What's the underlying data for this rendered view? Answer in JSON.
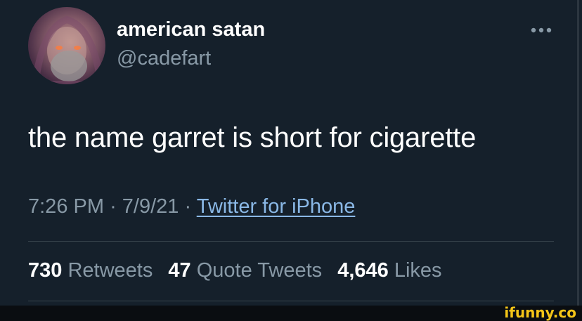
{
  "user": {
    "display_name": "american satan",
    "handle": "@cadefart"
  },
  "tweet": {
    "text": "the name garret is short for cigarette",
    "time": "7:26 PM",
    "date": "7/9/21",
    "separator": "·",
    "source": "Twitter for iPhone"
  },
  "stats": {
    "retweets_count": "730",
    "retweets_label": "Retweets",
    "quotes_count": "47",
    "quotes_label": "Quote Tweets",
    "likes_count": "4,646",
    "likes_label": "Likes"
  },
  "watermark": "ifunny.co",
  "colors": {
    "background": "#15202b",
    "primary_text": "#ffffff",
    "secondary_text": "#8899a6",
    "link": "#8ab8e6",
    "watermark": "#f5c518"
  },
  "icons": {
    "more": "more-horizontal-icon"
  }
}
